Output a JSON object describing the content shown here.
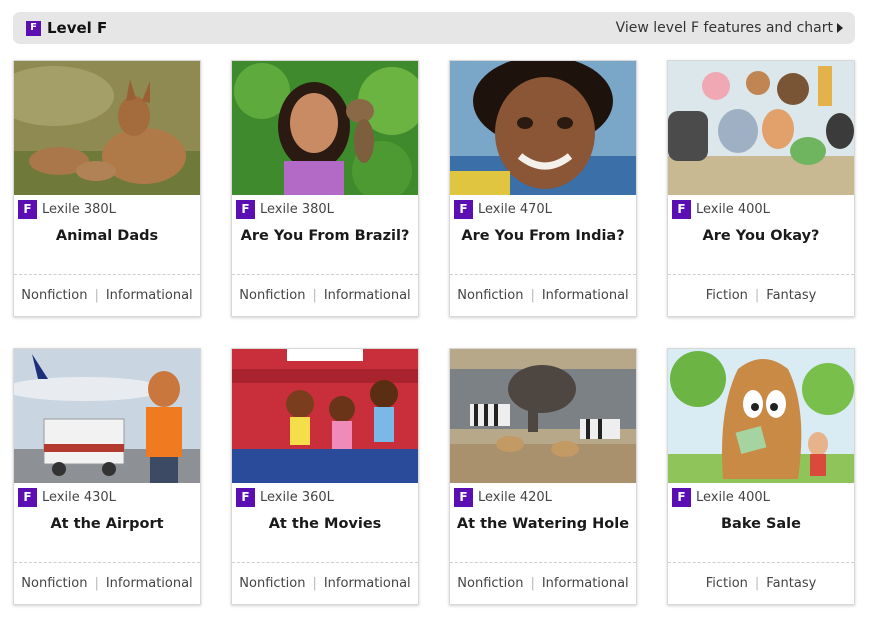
{
  "level": {
    "badge": "F",
    "title": "Level F",
    "link_label": "View level F features and chart"
  },
  "colors": {
    "badge_purple": "#5b0fb3",
    "header_gray": "#e6e6e6"
  },
  "books": [
    {
      "badge": "F",
      "lexile": "Lexile 380L",
      "title": "Animal Dads",
      "genre": "Nonfiction",
      "type": "Informational",
      "image": "jackal-family-photo"
    },
    {
      "badge": "F",
      "lexile": "Lexile 380L",
      "title": "Are You From Brazil?",
      "genre": "Nonfiction",
      "type": "Informational",
      "image": "girl-with-monkey-photo"
    },
    {
      "badge": "F",
      "lexile": "Lexile 470L",
      "title": "Are You From India?",
      "genre": "Nonfiction",
      "type": "Informational",
      "image": "smiling-girl-photo"
    },
    {
      "badge": "F",
      "lexile": "Lexile 400L",
      "title": "Are You Okay?",
      "genre": "Fiction",
      "type": "Fantasy",
      "image": "cartoon-animals-illustration"
    },
    {
      "badge": "F",
      "lexile": "Lexile 430L",
      "title": "At the Airport",
      "genre": "Nonfiction",
      "type": "Informational",
      "image": "child-at-airport-photo"
    },
    {
      "badge": "F",
      "lexile": "Lexile 360L",
      "title": "At the Movies",
      "genre": "Nonfiction",
      "type": "Informational",
      "image": "kids-in-theater-illustration"
    },
    {
      "badge": "F",
      "lexile": "Lexile 420L",
      "title": "At the Watering Hole",
      "genre": "Nonfiction",
      "type": "Informational",
      "image": "elephant-zebras-photo"
    },
    {
      "badge": "F",
      "lexile": "Lexile 400L",
      "title": "Bake Sale",
      "genre": "Fiction",
      "type": "Fantasy",
      "image": "cartoon-tree-illustration"
    }
  ]
}
